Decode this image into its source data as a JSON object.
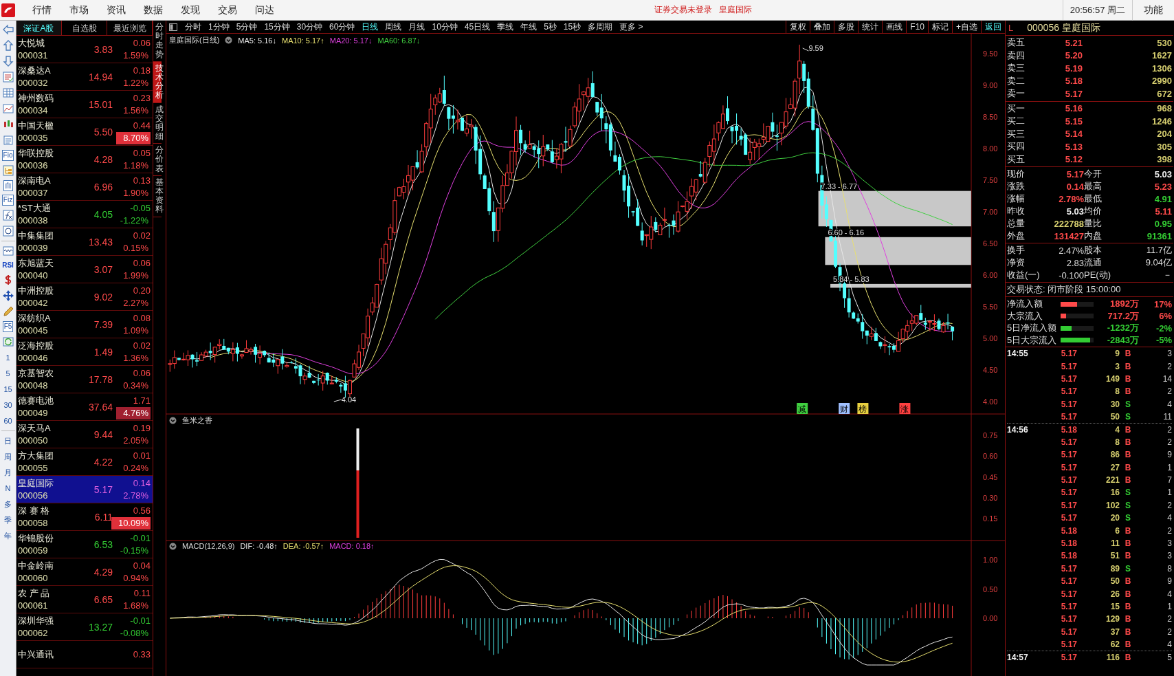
{
  "menu": {
    "items": [
      "行情",
      "市场",
      "资讯",
      "数据",
      "发现",
      "交易",
      "问达"
    ],
    "notice": "证券交易未登录",
    "notice_stock": "皇庭国际",
    "clock": "20:56:57 周二",
    "function": "功能"
  },
  "left_toolbar": {
    "labels": [
      "Fio",
      "自",
      "Fiz",
      "RSI",
      "F5",
      "1",
      "5",
      "15",
      "30",
      "60",
      "日",
      "周",
      "月",
      "N",
      "多",
      "季",
      "年"
    ]
  },
  "stock_list": {
    "tabs": [
      {
        "label": "深证A股",
        "selected": true
      },
      {
        "label": "自选股",
        "selected": false
      },
      {
        "label": "最近浏览",
        "selected": false
      }
    ],
    "rows": [
      {
        "name": "大悦城",
        "code": "000031",
        "price": "3.83",
        "change": "0.06",
        "pct": "1.59%",
        "up": true,
        "badge": false,
        "selected": false
      },
      {
        "name": "深桑达A",
        "code": "000032",
        "price": "14.94",
        "change": "0.18",
        "pct": "1.22%",
        "up": true,
        "badge": false,
        "selected": false
      },
      {
        "name": "神州数码",
        "code": "000034",
        "price": "15.01",
        "change": "0.23",
        "pct": "1.56%",
        "up": true,
        "badge": false,
        "selected": false
      },
      {
        "name": "中国天楹",
        "code": "000035",
        "price": "5.50",
        "change": "0.44",
        "pct": "8.70%",
        "up": true,
        "badge": true,
        "color": "#e0303a",
        "selected": false
      },
      {
        "name": "华联控股",
        "code": "000036",
        "price": "4.28",
        "change": "0.05",
        "pct": "1.18%",
        "up": true,
        "badge": false,
        "selected": false
      },
      {
        "name": "深南电A",
        "code": "000037",
        "price": "6.96",
        "change": "0.13",
        "pct": "1.90%",
        "up": true,
        "badge": false,
        "selected": false
      },
      {
        "name": "*ST大通",
        "code": "000038",
        "price": "4.05",
        "change": "-0.05",
        "pct": "-1.22%",
        "up": false,
        "badge": false,
        "selected": false
      },
      {
        "name": "中集集团",
        "code": "000039",
        "price": "13.43",
        "change": "0.02",
        "pct": "0.15%",
        "up": true,
        "badge": false,
        "selected": false
      },
      {
        "name": "东旭蓝天",
        "code": "000040",
        "price": "3.07",
        "change": "0.06",
        "pct": "1.99%",
        "up": true,
        "badge": false,
        "selected": false
      },
      {
        "name": "中洲控股",
        "code": "000042",
        "price": "9.02",
        "change": "0.20",
        "pct": "2.27%",
        "up": true,
        "badge": false,
        "selected": false
      },
      {
        "name": "深纺织A",
        "code": "000045",
        "price": "7.39",
        "change": "0.08",
        "pct": "1.09%",
        "up": true,
        "badge": false,
        "selected": false
      },
      {
        "name": "泛海控股",
        "code": "000046",
        "price": "1.49",
        "change": "0.02",
        "pct": "1.36%",
        "up": true,
        "badge": false,
        "selected": false
      },
      {
        "name": "京基智农",
        "code": "000048",
        "price": "17.78",
        "change": "0.06",
        "pct": "0.34%",
        "up": true,
        "badge": false,
        "selected": false
      },
      {
        "name": "德赛电池",
        "code": "000049",
        "price": "37.64",
        "change": "1.71",
        "pct": "4.76%",
        "up": true,
        "badge": true,
        "color": "#a02030",
        "selected": false
      },
      {
        "name": "深天马A",
        "code": "000050",
        "price": "9.44",
        "change": "0.19",
        "pct": "2.05%",
        "up": true,
        "badge": false,
        "selected": false
      },
      {
        "name": "方大集团",
        "code": "000055",
        "price": "4.22",
        "change": "0.01",
        "pct": "0.24%",
        "up": true,
        "badge": false,
        "selected": false
      },
      {
        "name": "皇庭国际",
        "code": "000056",
        "price": "5.17",
        "change": "0.14",
        "pct": "2.78%",
        "up": true,
        "badge": false,
        "selected": true
      },
      {
        "name": "深 赛 格",
        "code": "000058",
        "price": "6.11",
        "change": "0.56",
        "pct": "10.09%",
        "up": true,
        "badge": true,
        "color": "#e0303a",
        "selected": false
      },
      {
        "name": "华锦股份",
        "code": "000059",
        "price": "6.53",
        "change": "-0.01",
        "pct": "-0.15%",
        "up": false,
        "badge": false,
        "selected": false
      },
      {
        "name": "中金岭南",
        "code": "000060",
        "price": "4.29",
        "change": "0.04",
        "pct": "0.94%",
        "up": true,
        "badge": false,
        "selected": false
      },
      {
        "name": "农 产 品",
        "code": "000061",
        "price": "6.65",
        "change": "0.11",
        "pct": "1.68%",
        "up": true,
        "badge": false,
        "selected": false
      },
      {
        "name": "深圳华强",
        "code": "000062",
        "price": "13.27",
        "change": "-0.01",
        "pct": "-0.08%",
        "up": false,
        "badge": false,
        "selected": false
      },
      {
        "name": "中兴通讯",
        "change": "0.33",
        "up": true,
        "selected": false
      }
    ]
  },
  "view_tabs": [
    {
      "label": "分时走势",
      "selected": false
    },
    {
      "label": "技术分析",
      "selected": true
    },
    {
      "label": "成交明细",
      "selected": false
    },
    {
      "label": "分价表",
      "selected": false
    },
    {
      "label": "基本资料",
      "selected": false
    }
  ],
  "periods": [
    {
      "label": "分时",
      "selected": false
    },
    {
      "label": "1分钟",
      "selected": false
    },
    {
      "label": "5分钟",
      "selected": false
    },
    {
      "label": "15分钟",
      "selected": false
    },
    {
      "label": "30分钟",
      "selected": false
    },
    {
      "label": "60分钟",
      "selected": false
    },
    {
      "label": "日线",
      "selected": true
    },
    {
      "label": "周线",
      "selected": false
    },
    {
      "label": "月线",
      "selected": false
    },
    {
      "label": "10分钟",
      "selected": false
    },
    {
      "label": "45日线",
      "selected": false
    },
    {
      "label": "季线",
      "selected": false
    },
    {
      "label": "年线",
      "selected": false
    },
    {
      "label": "5秒",
      "selected": false
    },
    {
      "label": "15秒",
      "selected": false
    },
    {
      "label": "多周期",
      "selected": false
    },
    {
      "label": "更多 >",
      "selected": false
    }
  ],
  "chart_buttons": [
    {
      "label": "复权",
      "selected": false
    },
    {
      "label": "叠加",
      "selected": false
    },
    {
      "label": "多股",
      "selected": false
    },
    {
      "label": "统计",
      "selected": false
    },
    {
      "label": "画线",
      "selected": false
    },
    {
      "label": "F10",
      "selected": false
    },
    {
      "label": "标记",
      "selected": false
    },
    {
      "label": "+自选",
      "selected": false
    },
    {
      "label": "返回",
      "selected": true
    }
  ],
  "main_chart": {
    "title": "皇庭国际(日线)",
    "averages": [
      {
        "label": "MA5: 5.16↓",
        "color": "#e8e8e8"
      },
      {
        "label": "MA10: 5.17↑",
        "color": "#e8e070"
      },
      {
        "label": "MA20: 5.17↓",
        "color": "#e040e0"
      },
      {
        "label": "MA60: 6.87↓",
        "color": "#40d040"
      }
    ],
    "price_axis": [
      "9.50",
      "9.00",
      "8.50",
      "8.00",
      "7.50",
      "7.00",
      "6.50",
      "6.00",
      "5.50",
      "5.00",
      "4.50",
      "4.00"
    ],
    "high_label": "9.59",
    "low_label": "4.04",
    "gaps": [
      {
        "label": "7.33 - 6.77"
      },
      {
        "label": "6.60 - 6.16"
      },
      {
        "label": "5.84 - 5.83"
      }
    ],
    "markers": [
      {
        "label": "减",
        "color": "#40d040"
      },
      {
        "label": "财",
        "color": "#a0c0ff"
      },
      {
        "label": "榜",
        "color": "#e8d040"
      },
      {
        "label": "涨",
        "color": "#ff4040"
      }
    ]
  },
  "indicator": {
    "title": "鱼米之香",
    "axis": [
      "0.75",
      "0.60",
      "0.45",
      "0.30",
      "0.15"
    ]
  },
  "macd": {
    "title": "MACD(12,26,9)",
    "values": [
      {
        "label": "DIF: -0.48↑",
        "color": "#e8e8e8"
      },
      {
        "label": "DEA: -0.57↑",
        "color": "#e8e070"
      },
      {
        "label": "MACD: 0.18↑",
        "color": "#e040e0"
      }
    ],
    "axis": [
      "1.00",
      "0.50",
      "0.00"
    ]
  },
  "quote": {
    "marker": "L",
    "title": "000056 皇庭国际",
    "asks": [
      {
        "label": "卖五",
        "price": "5.21",
        "volume": "530"
      },
      {
        "label": "卖四",
        "price": "5.20",
        "volume": "1627"
      },
      {
        "label": "卖三",
        "price": "5.19",
        "volume": "1306"
      },
      {
        "label": "卖二",
        "price": "5.18",
        "volume": "2990"
      },
      {
        "label": "卖一",
        "price": "5.17",
        "volume": "672"
      }
    ],
    "bids": [
      {
        "label": "买一",
        "price": "5.16",
        "volume": "968"
      },
      {
        "label": "买二",
        "price": "5.15",
        "volume": "1246"
      },
      {
        "label": "买三",
        "price": "5.14",
        "volume": "204"
      },
      {
        "label": "买四",
        "price": "5.13",
        "volume": "305"
      },
      {
        "label": "买五",
        "price": "5.12",
        "volume": "398"
      }
    ],
    "stats": [
      {
        "label": "现价",
        "value": "5.17",
        "color": "#ff4a4a"
      },
      {
        "label": "今开",
        "value": "5.03",
        "color": "#f0f0f0"
      },
      {
        "label": "涨跌",
        "value": "0.14",
        "color": "#ff4a4a"
      },
      {
        "label": "最高",
        "value": "5.23",
        "color": "#ff4a4a"
      },
      {
        "label": "涨幅",
        "value": "2.78%",
        "color": "#ff4a4a"
      },
      {
        "label": "最低",
        "value": "4.91",
        "color": "#33cc33"
      },
      {
        "label": "昨收",
        "value": "5.03",
        "color": "#f0f0f0"
      },
      {
        "label": "均价",
        "value": "5.11",
        "color": "#ff4a4a"
      },
      {
        "label": "总量",
        "value": "222788",
        "color": "#d8d070"
      },
      {
        "label": "量比",
        "value": "0.95",
        "color": "#33cc33"
      },
      {
        "label": "外盘",
        "value": "131427",
        "color": "#ff4a4a"
      },
      {
        "label": "内盘",
        "value": "91361",
        "color": "#33cc33"
      }
    ],
    "fundamentals": [
      {
        "label": "换手",
        "value": "2.47%",
        "label2": "股本",
        "value2": "11.7亿"
      },
      {
        "label": "净资",
        "value": "2.83",
        "label2": "流通",
        "value2": "9.04亿"
      },
      {
        "label": "收益(一)",
        "value": "-0.100",
        "label2": "PE(动)",
        "value2": "－"
      }
    ],
    "status": "交易状态: 闭市阶段 15:00:00",
    "flows": [
      {
        "label": "净流入额",
        "level": 0.5,
        "value": "1892万",
        "pct": "17%",
        "color": "#ff4a4a"
      },
      {
        "label": "大宗流入",
        "level": 0.16,
        "value": "717.2万",
        "pct": "6%",
        "color": "#ff4a4a"
      },
      {
        "label": "5日净流入额",
        "level": 0.33,
        "value": "-1232万",
        "pct": "-2%",
        "color": "#33cc33"
      },
      {
        "label": "5日大宗流入",
        "level": 0.9,
        "value": "-2843万",
        "pct": "-5%",
        "color": "#33cc33"
      }
    ],
    "trades": [
      {
        "time": "14:55",
        "price": "5.17",
        "volume": "9",
        "side": "B",
        "count": "3"
      },
      {
        "price": "5.17",
        "volume": "3",
        "side": "B",
        "count": "2"
      },
      {
        "price": "5.17",
        "volume": "149",
        "side": "B",
        "count": "14"
      },
      {
        "price": "5.17",
        "volume": "8",
        "side": "B",
        "count": "2"
      },
      {
        "price": "5.17",
        "volume": "30",
        "side": "S",
        "count": "4"
      },
      {
        "price": "5.17",
        "volume": "50",
        "side": "S",
        "count": "11"
      },
      {
        "time": "14:56",
        "price": "5.18",
        "volume": "4",
        "side": "B",
        "count": "2"
      },
      {
        "price": "5.17",
        "volume": "8",
        "side": "B",
        "count": "2"
      },
      {
        "price": "5.17",
        "volume": "86",
        "side": "B",
        "count": "9"
      },
      {
        "price": "5.17",
        "volume": "27",
        "side": "B",
        "count": "1"
      },
      {
        "price": "5.17",
        "volume": "221",
        "side": "B",
        "count": "7"
      },
      {
        "price": "5.17",
        "volume": "16",
        "side": "S",
        "count": "1"
      },
      {
        "price": "5.17",
        "volume": "102",
        "side": "S",
        "count": "2"
      },
      {
        "price": "5.17",
        "volume": "20",
        "side": "S",
        "count": "4"
      },
      {
        "price": "5.18",
        "volume": "6",
        "side": "B",
        "count": "2"
      },
      {
        "price": "5.18",
        "volume": "11",
        "side": "B",
        "count": "3"
      },
      {
        "price": "5.18",
        "volume": "51",
        "side": "B",
        "count": "3"
      },
      {
        "price": "5.17",
        "volume": "89",
        "side": "S",
        "count": "8"
      },
      {
        "price": "5.17",
        "volume": "50",
        "side": "B",
        "count": "9"
      },
      {
        "price": "5.17",
        "volume": "26",
        "side": "B",
        "count": "4"
      },
      {
        "price": "5.17",
        "volume": "15",
        "side": "B",
        "count": "1"
      },
      {
        "price": "5.17",
        "volume": "129",
        "side": "B",
        "count": "2"
      },
      {
        "price": "5.17",
        "volume": "37",
        "side": "B",
        "count": "2"
      },
      {
        "price": "5.17",
        "volume": "62",
        "side": "B",
        "count": "4"
      },
      {
        "time": "14:57",
        "price": "5.17",
        "volume": "116",
        "side": "B",
        "count": "5"
      }
    ]
  }
}
